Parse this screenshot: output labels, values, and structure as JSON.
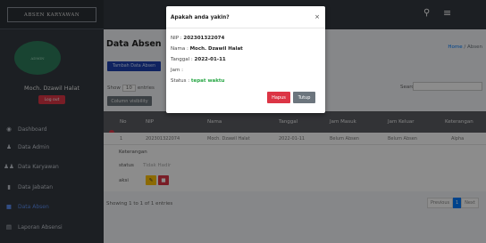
{
  "brand": "ABSEN KARYAWAN",
  "topbar": {
    "search_icon": "search-icon",
    "menu_icon": "hamburger-icon"
  },
  "sidebar": {
    "avatar_text": "ADMIN",
    "user_name": "Moch. Dzawil Halat",
    "logout_label": "Log out",
    "items": [
      {
        "label": "Dashboard",
        "icon": "dashboard-icon"
      },
      {
        "label": "Data Admin",
        "icon": "user-icon"
      },
      {
        "label": "Data Karyawan",
        "icon": "users-icon"
      },
      {
        "label": "Data Jabatan",
        "icon": "file-icon"
      },
      {
        "label": "Data Absen",
        "icon": "book-icon"
      },
      {
        "label": "Laporan Absensi",
        "icon": "report-icon"
      }
    ]
  },
  "main": {
    "title": "Data Absen",
    "breadcrumb_home": "Home",
    "breadcrumb_sep": " / ",
    "breadcrumb_current": "Absen",
    "add_button": "Tambah Data Absen",
    "show_label": "Show",
    "show_value": "10",
    "entries_label": "entries",
    "colvis_label": "Column visibility",
    "search_label": "Search:",
    "search_value": "",
    "columns": [
      "No",
      "NIP",
      "Nama",
      "Tanggal",
      "Jam Masuk",
      "Jam Keluar",
      "Keterangan"
    ],
    "rows": [
      {
        "no": "1",
        "nip": "202301322074",
        "nama": "Moch. Dzawil Halat",
        "tanggal": "2022-01-11",
        "jam_masuk": "Belum Absen",
        "jam_keluar": "Belum Absen",
        "keterangan": "Alpha"
      }
    ],
    "details": {
      "title": "Keterangan",
      "status_label": "status",
      "status_value": "Tidak Hadir",
      "aksi_label": "aksi"
    },
    "showing": "Showing 1 to 1 of 1 entries",
    "pager": {
      "prev": "Previous",
      "current": "1",
      "next": "Next"
    }
  },
  "modal": {
    "title": "Apakah anda yakin?",
    "close": "×",
    "nip_label": "NIP :",
    "nip_value": "202301322074",
    "nama_label": "Nama :",
    "nama_value": "Moch. Dzawil Halat",
    "tanggal_label": "Tanggal :",
    "tanggal_value": "2022-01-11",
    "jam_label": "Jam :",
    "jam_value": "",
    "status_label": "Status :",
    "status_value": "tepat waktu",
    "hapus": "Hapus",
    "tutup": "Tutup"
  },
  "colors": {
    "sidebar": "#343a40",
    "accent": "#007bff",
    "danger": "#dc3545",
    "warning": "#ffc107",
    "success": "#28a745"
  }
}
